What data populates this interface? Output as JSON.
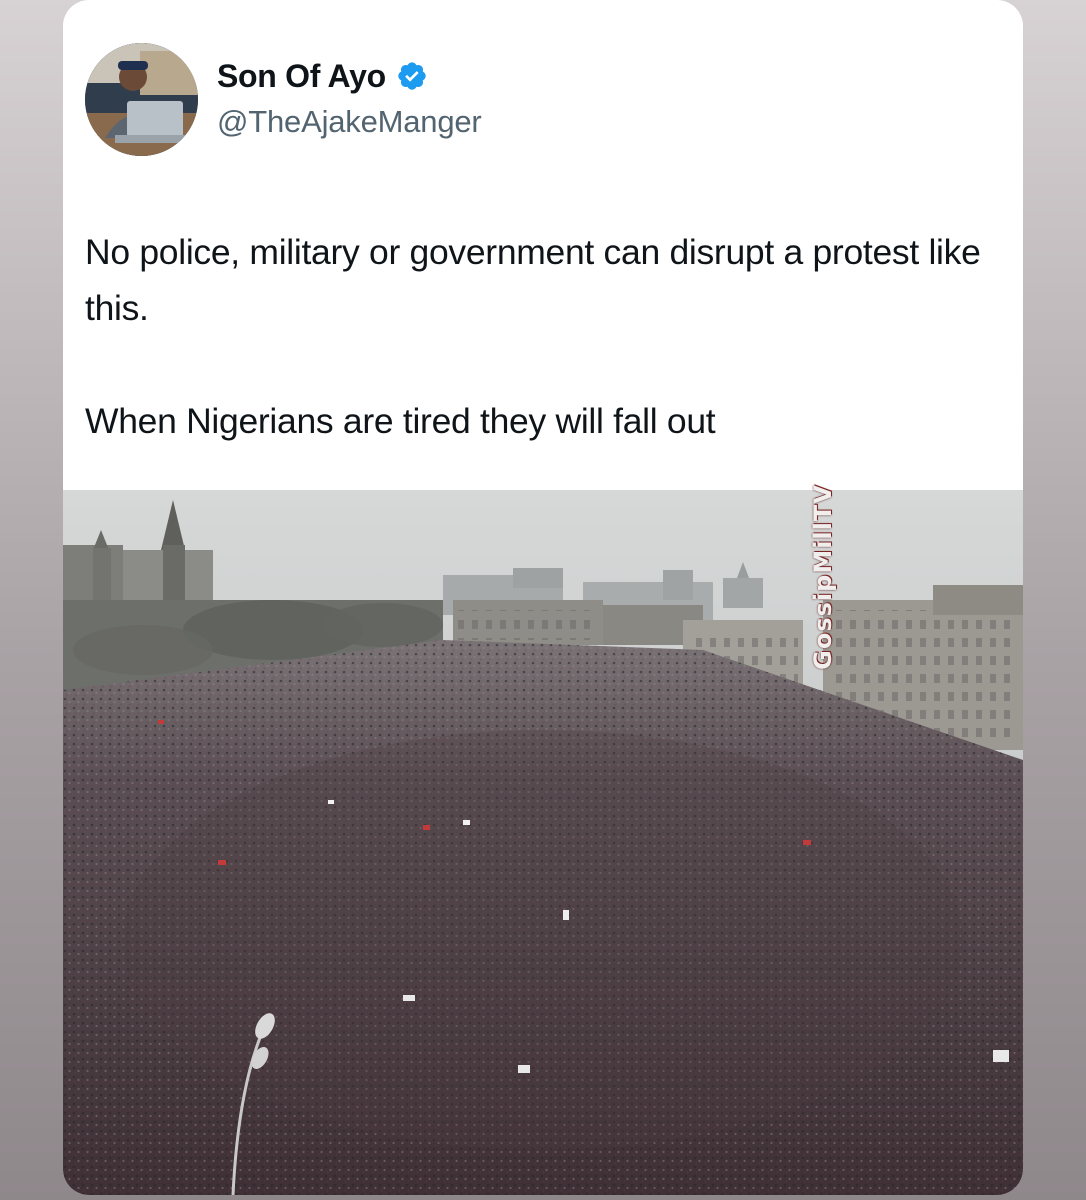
{
  "tweet": {
    "author": {
      "display_name": "Son Of Ayo",
      "handle": "@TheAjakeManger",
      "verified": true,
      "avatar_icon": "avatar-photo"
    },
    "text_paragraphs": [
      "No police, military or government can disrupt a protest like this.",
      "When Nigerians are tired they will fall out"
    ],
    "media": {
      "type": "photo",
      "subject": "aerial-crowd-photo",
      "watermark": "GossipMillTV"
    }
  },
  "colors": {
    "background": "#a9a2a5",
    "card": "#ffffff",
    "text_primary": "#0f1419",
    "text_secondary": "#536471",
    "verified_badge": "#1d9bf0"
  }
}
